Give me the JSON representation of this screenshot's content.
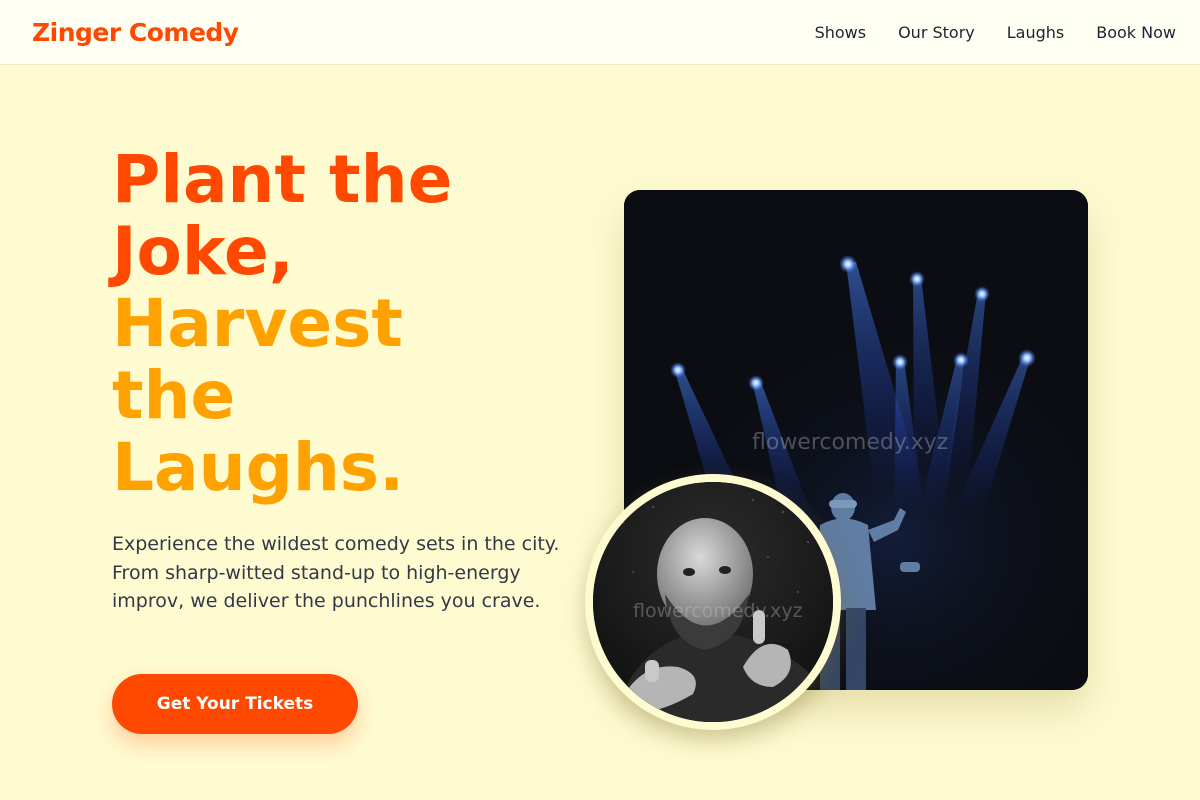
{
  "brand": {
    "name": "Zinger Comedy",
    "primary": "#FF4800",
    "secondary": "#FFA200",
    "background": "#FFFBD1"
  },
  "nav": {
    "items": [
      {
        "label": "Shows"
      },
      {
        "label": "Our Story"
      },
      {
        "label": "Laughs"
      },
      {
        "label": "Book Now"
      }
    ]
  },
  "hero": {
    "title_line1": "Plant the",
    "title_line2": "Joke,",
    "title_line3": "Harvest",
    "title_line4": "the",
    "title_line5": "Laughs.",
    "description": "Experience the wildest comedy sets in the city. From sharp-witted stand-up to high-energy improv, we deliver the punchlines you crave.",
    "cta_label": "Get Your Tickets"
  },
  "images": {
    "stage_watermark": "flowercomedy.xyz",
    "portrait_watermark": "flowercomedy.xyz"
  }
}
